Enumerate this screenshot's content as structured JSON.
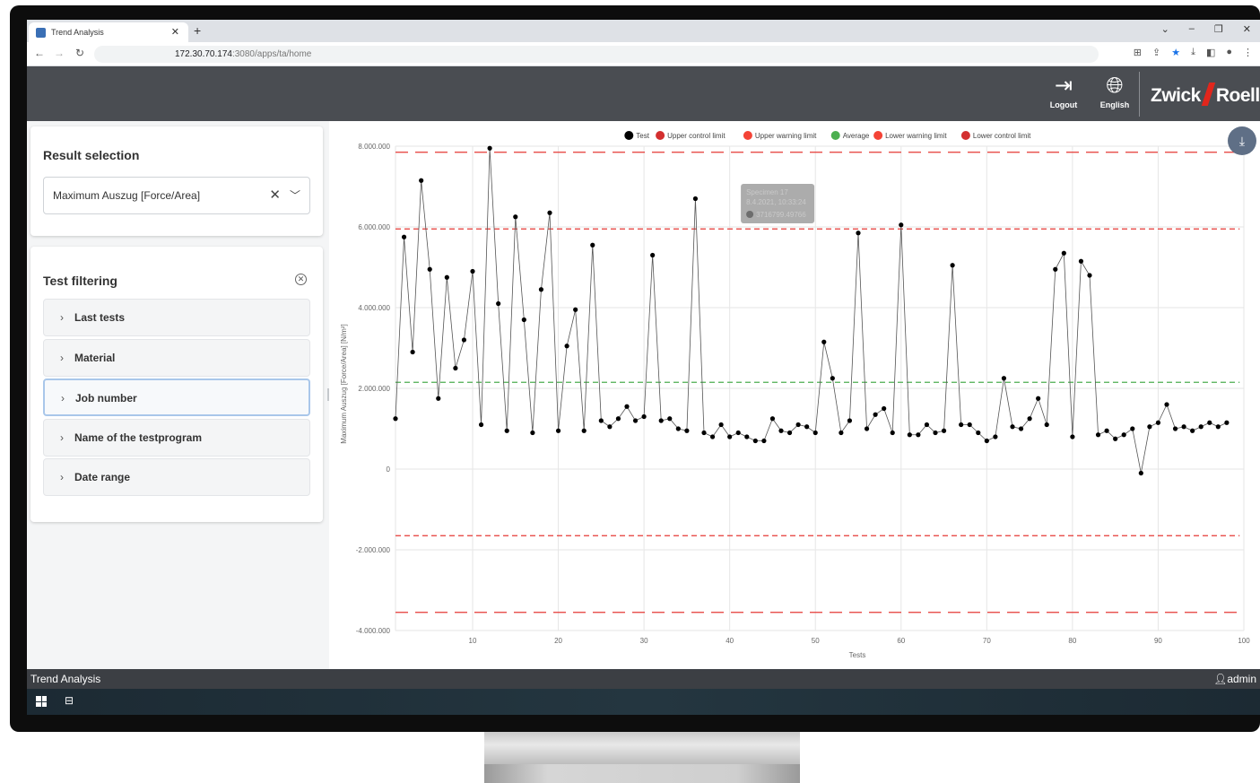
{
  "browser": {
    "tab_title": "Trend Analysis",
    "url_host": "172.30.70.174",
    "url_rest": ":3080/apps/ta/home"
  },
  "header": {
    "logout_label": "Logout",
    "language_label": "English",
    "brand_left": "Zwick",
    "brand_right": "Roell"
  },
  "result_selection": {
    "title": "Result selection",
    "selected": "Maximum Auszug [Force/Area]"
  },
  "test_filtering": {
    "title": "Test filtering",
    "items": [
      {
        "label": "Last tests"
      },
      {
        "label": "Material"
      },
      {
        "label": "Job number"
      },
      {
        "label": "Name of the testprogram"
      },
      {
        "label": "Date range"
      }
    ]
  },
  "tooltip": {
    "line1": "Specimen 17",
    "line2": "8.4.2021, 10:33:24",
    "line3": "3716799.49766"
  },
  "statusbar": {
    "app_name": "Trend Analysis",
    "user": "admin"
  },
  "colors": {
    "header_bg": "#4a4d52",
    "limit_red": "#e1261c",
    "average_green": "#4caf50",
    "download_btn": "#5f6f86"
  },
  "chart_data": {
    "type": "line",
    "xlabel": "Tests",
    "ylabel": "Maximum Auszug [Force/Area] [N/m²]",
    "xlim": [
      1,
      100
    ],
    "ylim": [
      -4000000,
      8000000
    ],
    "x_ticks": [
      10,
      20,
      30,
      40,
      50,
      60,
      70,
      80,
      90,
      100
    ],
    "y_ticks": [
      -4000000,
      -2000000,
      0,
      2000000,
      4000000,
      6000000,
      8000000
    ],
    "y_tick_labels": [
      "-4.000.000",
      "-2.000.000",
      "0",
      "2.000.000",
      "4.000.000",
      "6.000.000",
      "8.000.000"
    ],
    "legend_position": "top-center",
    "legend": [
      {
        "name": "Test",
        "color": "#000000"
      },
      {
        "name": "Upper control limit",
        "color": "#d32f2f"
      },
      {
        "name": "Upper warning limit",
        "color": "#f44336"
      },
      {
        "name": "Average",
        "color": "#4caf50"
      },
      {
        "name": "Lower warning limit",
        "color": "#f44336"
      },
      {
        "name": "Lower control limit",
        "color": "#d32f2f"
      }
    ],
    "limits": {
      "upper_control": 7850000,
      "upper_warning": 5950000,
      "average": 2150000,
      "lower_warning": -1650000,
      "lower_control": -3550000
    },
    "series": [
      {
        "name": "Test",
        "x": [
          1,
          2,
          3,
          4,
          5,
          6,
          7,
          8,
          9,
          10,
          11,
          12,
          13,
          14,
          15,
          16,
          17,
          18,
          19,
          20,
          21,
          22,
          23,
          24,
          25,
          26,
          27,
          28,
          29,
          30,
          31,
          32,
          33,
          34,
          35,
          36,
          37,
          38,
          39,
          40,
          41,
          42,
          43,
          44,
          45,
          46,
          47,
          48,
          49,
          50,
          51,
          52,
          53,
          54,
          55,
          56,
          57,
          58,
          59,
          60,
          61,
          62,
          63,
          64,
          65,
          66,
          67,
          68,
          69,
          70,
          71,
          72,
          73,
          74,
          75,
          76,
          77,
          78,
          79,
          80,
          81,
          82,
          83,
          84,
          85,
          86,
          87,
          88,
          89,
          90,
          91,
          92,
          93,
          94,
          95,
          96,
          97,
          98
        ],
        "values": [
          1250000,
          5750000,
          2900000,
          7150000,
          4950000,
          1750000,
          4750000,
          2500000,
          3200000,
          4900000,
          1100000,
          7950000,
          4100000,
          950000,
          6250000,
          3700000,
          900000,
          4450000,
          6350000,
          950000,
          3050000,
          3950000,
          950000,
          5550000,
          1200000,
          1050000,
          1250000,
          1550000,
          1200000,
          1300000,
          5300000,
          1200000,
          1250000,
          1000000,
          950000,
          6700000,
          900000,
          800000,
          1100000,
          800000,
          900000,
          800000,
          700000,
          700000,
          1250000,
          950000,
          900000,
          1100000,
          1050000,
          900000,
          3150000,
          2250000,
          900000,
          1200000,
          5850000,
          1000000,
          1350000,
          1500000,
          900000,
          6050000,
          850000,
          850000,
          1100000,
          900000,
          950000,
          5050000,
          1100000,
          1100000,
          900000,
          700000,
          800000,
          2250000,
          1050000,
          1000000,
          1250000,
          1750000,
          1100000,
          4950000,
          5350000,
          800000,
          5150000,
          4800000,
          850000,
          950000,
          750000,
          850000,
          1000000,
          -100000,
          1050000,
          1150000,
          1600000,
          1000000,
          1050000,
          950000,
          1050000,
          1150000,
          1050000,
          1150000
        ]
      }
    ]
  }
}
